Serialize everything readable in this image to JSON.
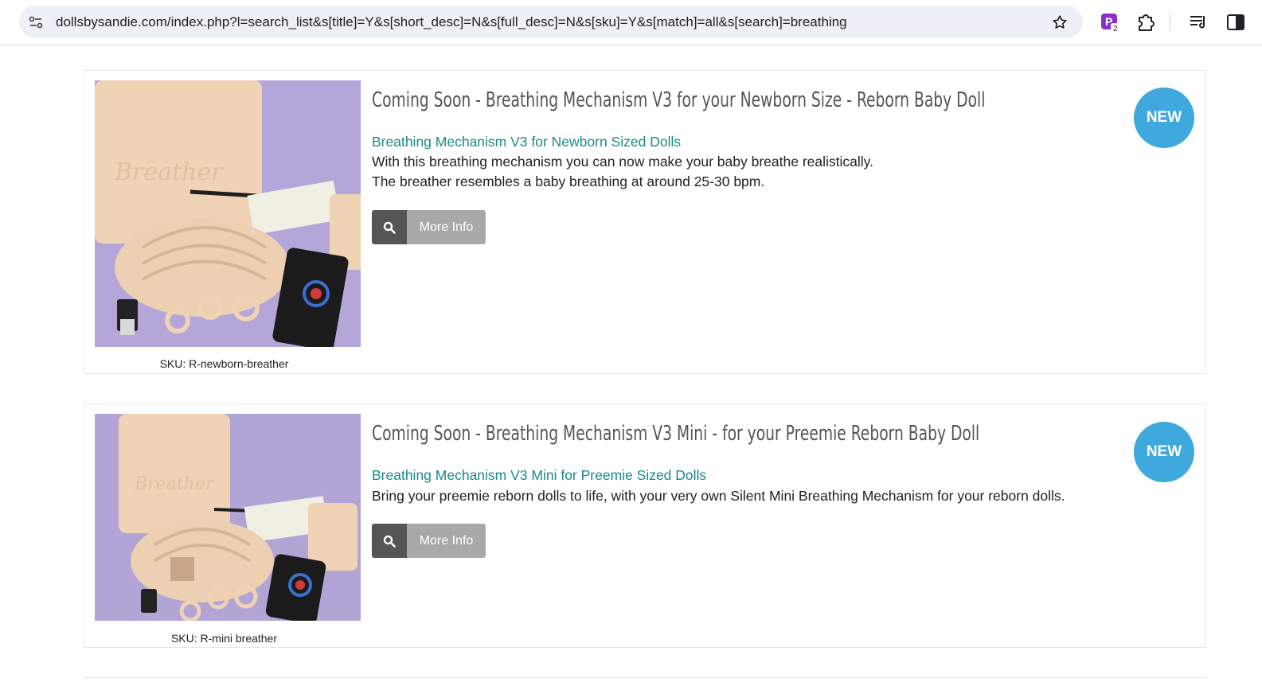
{
  "browser": {
    "url": "dollsbysandie.com/index.php?l=search_list&s[title]=Y&s[short_desc]=N&s[full_desc]=N&s[sku]=Y&s[match]=all&s[search]=breathing",
    "extension_badge_count": "2",
    "icons": [
      "site-info-icon",
      "bookmark-star-icon",
      "extension-p-icon",
      "extensions-puzzle-icon",
      "reading-list-icon",
      "side-panel-icon"
    ]
  },
  "colors": {
    "title": "#555555",
    "short_desc": "#1a8a8a",
    "badge": "#3fa9de",
    "button_icon_bg": "#555555",
    "button_label_bg": "#a9a9a9"
  },
  "products": [
    {
      "title": "Coming Soon - Breathing Mechanism V3 for your Newborn Size - Reborn Baby Doll",
      "short_desc": "Breathing Mechanism V3 for Newborn Sized Dolls",
      "description": [
        "With this breathing mechanism you can now make your baby breathe realistically.",
        "The breather resembles a baby breathing at around 25-30 bpm."
      ],
      "button_label": "More Info",
      "badge": "NEW",
      "sku": "SKU: R-newborn-breather",
      "image_alt": "Breather box with breathing mechanism, remote control and USB cable"
    },
    {
      "title": "Coming Soon - Breathing Mechanism V3 Mini - for your Preemie Reborn Baby Doll",
      "short_desc": "Breathing Mechanism V3 Mini for Preemie Sized Dolls",
      "description": [
        "Bring your preemie reborn dolls to life, with your very own Silent Mini Breathing Mechanism for your reborn dolls."
      ],
      "button_label": "More Info",
      "badge": "NEW",
      "sku": "SKU: R-mini breather",
      "image_alt": "Mini breather box with breathing mechanism, remote control and USB cable"
    }
  ]
}
